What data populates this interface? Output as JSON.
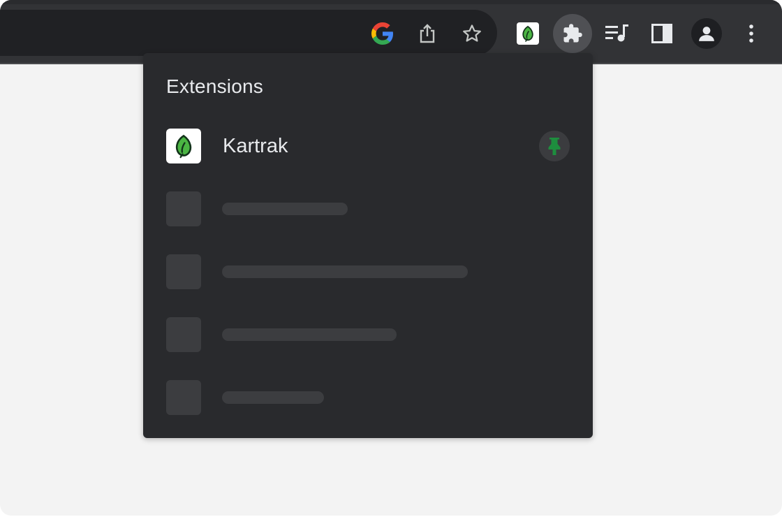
{
  "toolbar": {
    "icons": {
      "google": "google-icon",
      "share": "share-icon",
      "bookmark": "star-icon",
      "pinned_extension": "kartrak-leaf-icon",
      "extensions": "puzzle-icon",
      "media": "media-controls-icon",
      "side_panel": "side-panel-icon",
      "profile": "profile-icon",
      "menu": "more-vert-icon"
    }
  },
  "popup": {
    "title": "Extensions",
    "extensions": [
      {
        "name": "Kartrak",
        "icon": "leaf-icon",
        "pinned": true,
        "pin_color": "#1e8e3e"
      }
    ],
    "placeholder_rows": 4
  },
  "colors": {
    "toolbar_bg": "#323336",
    "omnibox_bg": "#202124",
    "popup_bg": "#292a2d",
    "page_bg": "#f3f3f3",
    "accent_green": "#1e8e3e"
  }
}
